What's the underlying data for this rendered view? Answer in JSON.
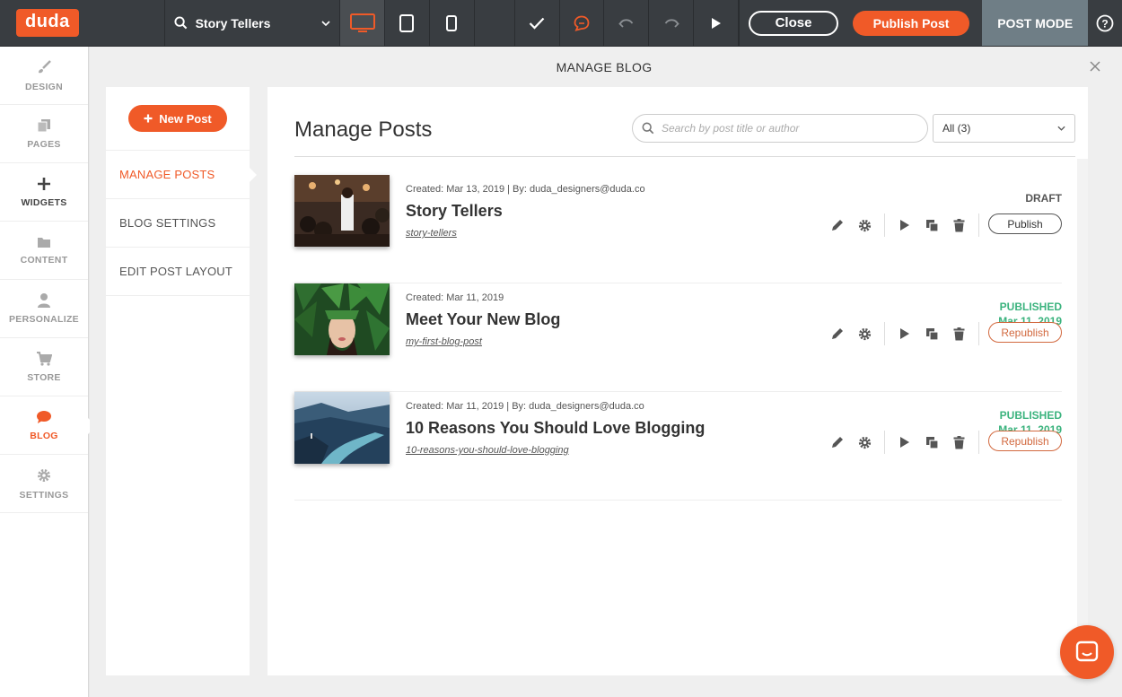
{
  "topbar": {
    "logo": "duda",
    "site_name": "Story Tellers",
    "close_label": "Close",
    "publish_label": "Publish Post",
    "mode_label": "POST MODE"
  },
  "leftnav": {
    "items": [
      {
        "label": "DESIGN",
        "icon": "brush-icon"
      },
      {
        "label": "PAGES",
        "icon": "pages-icon"
      },
      {
        "label": "WIDGETS",
        "icon": "plus-icon"
      },
      {
        "label": "CONTENT",
        "icon": "folder-icon"
      },
      {
        "label": "PERSONALIZE",
        "icon": "person-icon"
      },
      {
        "label": "STORE",
        "icon": "cart-icon"
      },
      {
        "label": "BLOG",
        "icon": "chat-icon"
      },
      {
        "label": "SETTINGS",
        "icon": "gear-icon"
      }
    ]
  },
  "modal": {
    "title": "MANAGE BLOG",
    "new_post_label": "New Post",
    "menu": [
      "MANAGE POSTS",
      "BLOG SETTINGS",
      "EDIT POST LAYOUT"
    ],
    "main_title": "Manage Posts",
    "search_placeholder": "Search by post title or author",
    "filter_value": "All (3)"
  },
  "posts": [
    {
      "meta": "Created: Mar 13, 2019 | By: duda_designers@duda.co",
      "title": "Story Tellers",
      "slug": "story-tellers",
      "status": "DRAFT",
      "status_date": "",
      "action": "Publish"
    },
    {
      "meta": "Created: Mar 11, 2019",
      "title": "Meet Your New Blog",
      "slug": "my-first-blog-post",
      "status": "PUBLISHED",
      "status_date": "Mar 11, 2019",
      "action": "Republish"
    },
    {
      "meta": "Created: Mar 11, 2019 | By: duda_designers@duda.co",
      "title": "10 Reasons You Should Love Blogging",
      "slug": "10-reasons-you-should-love-blogging",
      "status": "PUBLISHED",
      "status_date": "Mar 11, 2019",
      "action": "Republish"
    }
  ],
  "colors": {
    "accent": "#f05a28",
    "published": "#3bb37e",
    "topbar": "#393d41"
  }
}
